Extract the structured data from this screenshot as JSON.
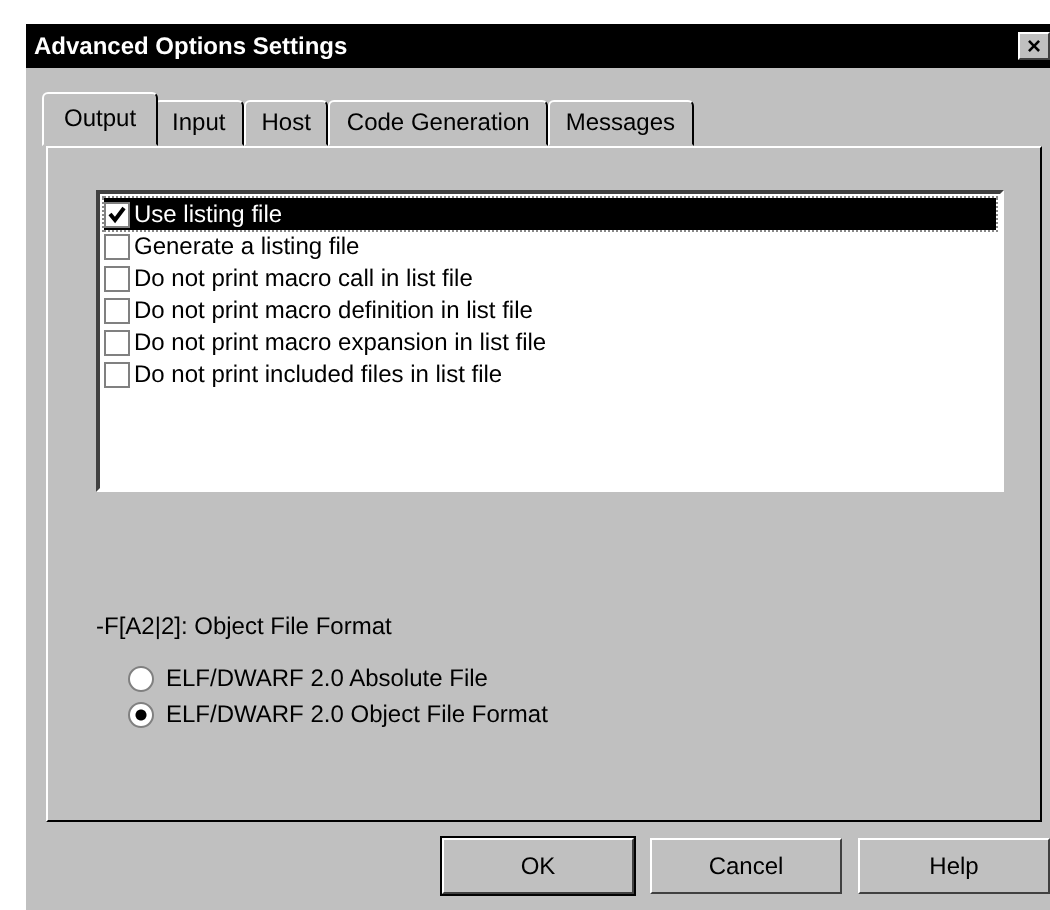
{
  "window": {
    "title": "Advanced Options Settings",
    "close": "×"
  },
  "tabs": [
    {
      "label": "Output",
      "selected": true
    },
    {
      "label": "Input",
      "selected": false
    },
    {
      "label": "Host",
      "selected": false
    },
    {
      "label": "Code Generation",
      "selected": false
    },
    {
      "label": "Messages",
      "selected": false
    }
  ],
  "options": [
    {
      "label": "Use listing file",
      "checked": true,
      "selected": true
    },
    {
      "label": "Generate a listing file",
      "checked": false,
      "selected": false
    },
    {
      "label": "Do not print macro call in list file",
      "checked": false,
      "selected": false
    },
    {
      "label": "Do not print macro definition in list file",
      "checked": false,
      "selected": false
    },
    {
      "label": "Do not print macro expansion in list file",
      "checked": false,
      "selected": false
    },
    {
      "label": "Do not print included files in list file",
      "checked": false,
      "selected": false
    }
  ],
  "format": {
    "label": "-F[A2|2]: Object File Format",
    "choices": [
      {
        "label": "ELF/DWARF 2.0 Absolute File",
        "selected": false
      },
      {
        "label": "ELF/DWARF 2.0 Object File Format",
        "selected": true
      }
    ]
  },
  "buttons": [
    {
      "label": "OK",
      "default": true
    },
    {
      "label": "Cancel",
      "default": false
    },
    {
      "label": "Help",
      "default": false
    }
  ]
}
